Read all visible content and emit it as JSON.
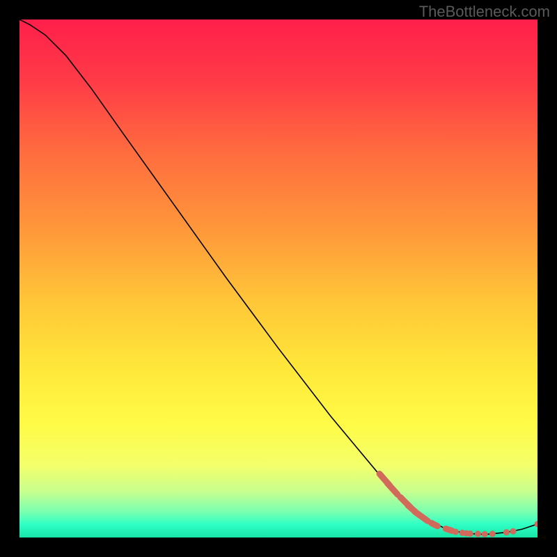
{
  "attribution": "TheBottleneck.com",
  "chart_data": {
    "type": "line",
    "title": "",
    "xlabel": "",
    "ylabel": "",
    "xlim": [
      0,
      100
    ],
    "ylim": [
      0,
      100
    ],
    "gradient_stops": [
      {
        "pct": 0,
        "color": "#ff1f4b"
      },
      {
        "pct": 12,
        "color": "#ff3b47"
      },
      {
        "pct": 25,
        "color": "#ff6a3f"
      },
      {
        "pct": 40,
        "color": "#ff963a"
      },
      {
        "pct": 55,
        "color": "#ffc838"
      },
      {
        "pct": 68,
        "color": "#ffe93a"
      },
      {
        "pct": 78,
        "color": "#fffb46"
      },
      {
        "pct": 86,
        "color": "#f4ff6a"
      },
      {
        "pct": 91,
        "color": "#c9ff8e"
      },
      {
        "pct": 95,
        "color": "#7affb0"
      },
      {
        "pct": 97.5,
        "color": "#2fffc5"
      },
      {
        "pct": 100,
        "color": "#17e4a6"
      }
    ],
    "curve": [
      {
        "x": 0,
        "y": 100
      },
      {
        "x": 2,
        "y": 99
      },
      {
        "x": 5,
        "y": 97
      },
      {
        "x": 9,
        "y": 93
      },
      {
        "x": 14,
        "y": 86.5
      },
      {
        "x": 20,
        "y": 78
      },
      {
        "x": 30,
        "y": 64
      },
      {
        "x": 40,
        "y": 50
      },
      {
        "x": 50,
        "y": 36.5
      },
      {
        "x": 60,
        "y": 23.5
      },
      {
        "x": 70,
        "y": 11.5
      },
      {
        "x": 77,
        "y": 4.5
      },
      {
        "x": 82,
        "y": 1.8
      },
      {
        "x": 86,
        "y": 0.8
      },
      {
        "x": 90,
        "y": 0.6
      },
      {
        "x": 94,
        "y": 1.0
      },
      {
        "x": 97,
        "y": 1.6
      },
      {
        "x": 100,
        "y": 2.6
      }
    ],
    "markers": [
      {
        "type": "stroke",
        "x1": 69.5,
        "y1": 12.3,
        "x2": 71.5,
        "y2": 10.0
      },
      {
        "type": "stroke",
        "x1": 71.0,
        "y1": 10.5,
        "x2": 73.0,
        "y2": 8.3
      },
      {
        "type": "stroke",
        "x1": 73.5,
        "y1": 7.8,
        "x2": 75.5,
        "y2": 5.8
      },
      {
        "type": "stroke",
        "x1": 75.0,
        "y1": 6.2,
        "x2": 76.5,
        "y2": 4.9
      },
      {
        "type": "stroke",
        "x1": 76.3,
        "y1": 5.0,
        "x2": 78.8,
        "y2": 3.2
      },
      {
        "type": "stroke",
        "x1": 79.5,
        "y1": 2.8,
        "x2": 80.7,
        "y2": 2.2
      },
      {
        "type": "stroke",
        "x1": 82.3,
        "y1": 1.7,
        "x2": 83.5,
        "y2": 1.3
      },
      {
        "type": "dot",
        "x": 84.2,
        "y": 1.1
      },
      {
        "type": "dot",
        "x": 85.5,
        "y": 0.9
      },
      {
        "type": "dot",
        "x": 86.3,
        "y": 0.8
      },
      {
        "type": "dot",
        "x": 87.0,
        "y": 0.75
      },
      {
        "type": "dot",
        "x": 88.5,
        "y": 0.7
      },
      {
        "type": "dot",
        "x": 89.8,
        "y": 0.65
      },
      {
        "type": "dot",
        "x": 91.3,
        "y": 0.7
      },
      {
        "type": "dot",
        "x": 94.0,
        "y": 1.0
      },
      {
        "type": "dot",
        "x": 95.3,
        "y": 1.2
      },
      {
        "type": "dot",
        "x": 100,
        "y": 2.6
      }
    ]
  }
}
